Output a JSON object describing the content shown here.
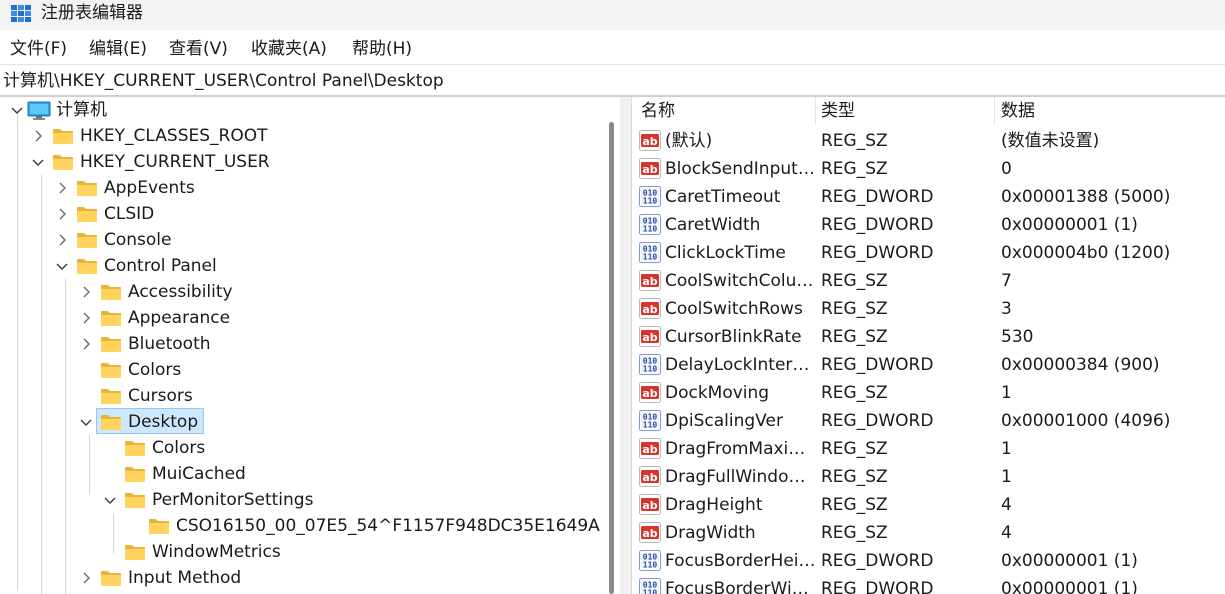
{
  "window": {
    "title": "注册表编辑器"
  },
  "menu": [
    "文件(F)",
    "编辑(E)",
    "查看(V)",
    "收藏夹(A)",
    "帮助(H)"
  ],
  "address": "计算机\\HKEY_CURRENT_USER\\Control Panel\\Desktop",
  "tree": {
    "root": "计算机",
    "hkcr": "HKEY_CLASSES_ROOT",
    "hkcu": "HKEY_CURRENT_USER",
    "appevents": "AppEvents",
    "clsid": "CLSID",
    "console": "Console",
    "control_panel": "Control Panel",
    "accessibility": "Accessibility",
    "appearance": "Appearance",
    "bluetooth": "Bluetooth",
    "colors": "Colors",
    "cursors": "Cursors",
    "desktop": "Desktop",
    "desktop_colors": "Colors",
    "muicached": "MuiCached",
    "permonitor": "PerMonitorSettings",
    "cso": "CSO16150_00_07E5_54^F1157F948DC35E1649A",
    "windowmetrics": "WindowMetrics",
    "input_method": "Input Method"
  },
  "list": {
    "headers": {
      "name": "名称",
      "type": "类型",
      "data": "数据"
    },
    "rows": [
      {
        "icon": "string-value-icon",
        "name": "(默认)",
        "type": "REG_SZ",
        "data": "(数值未设置)"
      },
      {
        "icon": "string-value-icon",
        "name": "BlockSendInput…",
        "type": "REG_SZ",
        "data": "0"
      },
      {
        "icon": "binary-value-icon",
        "name": "CaretTimeout",
        "type": "REG_DWORD",
        "data": "0x00001388 (5000)"
      },
      {
        "icon": "binary-value-icon",
        "name": "CaretWidth",
        "type": "REG_DWORD",
        "data": "0x00000001 (1)"
      },
      {
        "icon": "binary-value-icon",
        "name": "ClickLockTime",
        "type": "REG_DWORD",
        "data": "0x000004b0 (1200)"
      },
      {
        "icon": "string-value-icon",
        "name": "CoolSwitchColu…",
        "type": "REG_SZ",
        "data": "7"
      },
      {
        "icon": "string-value-icon",
        "name": "CoolSwitchRows",
        "type": "REG_SZ",
        "data": "3"
      },
      {
        "icon": "string-value-icon",
        "name": "CursorBlinkRate",
        "type": "REG_SZ",
        "data": "530"
      },
      {
        "icon": "binary-value-icon",
        "name": "DelayLockInter…",
        "type": "REG_DWORD",
        "data": "0x00000384 (900)"
      },
      {
        "icon": "string-value-icon",
        "name": "DockMoving",
        "type": "REG_SZ",
        "data": "1"
      },
      {
        "icon": "binary-value-icon",
        "name": "DpiScalingVer",
        "type": "REG_DWORD",
        "data": "0x00001000 (4096)"
      },
      {
        "icon": "string-value-icon",
        "name": "DragFromMaxi…",
        "type": "REG_SZ",
        "data": "1"
      },
      {
        "icon": "string-value-icon",
        "name": "DragFullWindo…",
        "type": "REG_SZ",
        "data": "1"
      },
      {
        "icon": "string-value-icon",
        "name": "DragHeight",
        "type": "REG_SZ",
        "data": "4"
      },
      {
        "icon": "string-value-icon",
        "name": "DragWidth",
        "type": "REG_SZ",
        "data": "4"
      },
      {
        "icon": "binary-value-icon",
        "name": "FocusBorderHei…",
        "type": "REG_DWORD",
        "data": "0x00000001 (1)"
      },
      {
        "icon": "binary-value-icon",
        "name": "FocusBorderWi…",
        "type": "REG_DWORD",
        "data": "0x00000001 (1)"
      }
    ]
  }
}
